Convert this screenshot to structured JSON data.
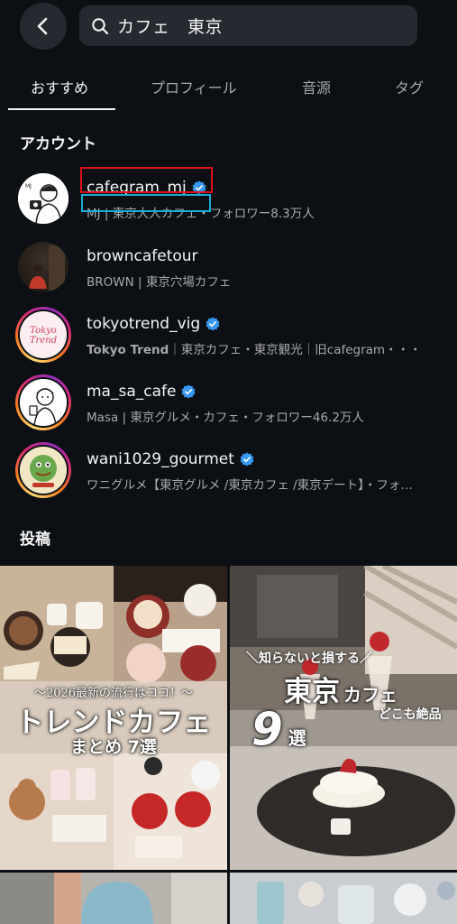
{
  "search": {
    "query": "カフェ　東京"
  },
  "tabs": [
    {
      "label": "おすすめ"
    },
    {
      "label": "プロフィール"
    },
    {
      "label": "音源"
    },
    {
      "label": "タグ"
    }
  ],
  "sections": {
    "accounts": "アカウント",
    "posts": "投稿"
  },
  "accounts": [
    {
      "username": "cafegram_mj",
      "verified": true,
      "sub_highlight": "MJ | 東京大人カフェ",
      "sub_rest": "・フォロワー8.3万人"
    },
    {
      "username": "browncafetour",
      "verified": false,
      "subtitle": "BROWN | 東京穴場カフェ"
    },
    {
      "username": "tokyotrend_vig",
      "verified": true,
      "sub_bold": "Tokyo Trend",
      "sub_rest": "｜東京カフェ・東京観光｜旧cafegram・・・",
      "avatar_text": "Tokyo Trend"
    },
    {
      "username": "ma_sa_cafe",
      "verified": true,
      "subtitle": "Masa | 東京グルメ・カフェ・フォロワー46.2万人"
    },
    {
      "username": "wani1029_gourmet",
      "verified": true,
      "subtitle": "ワニグルメ【東京グルメ /東京カフェ /東京デート】・フォ…"
    }
  ],
  "posts": [
    {
      "line1": "～2026最新の流行はココ！～",
      "line2": "トレンドカフェ",
      "line3": "まとめ 7選"
    },
    {
      "banner": "＼知らないと損する／",
      "big": "東京",
      "small": "カフェ",
      "tag": "どこも絶品",
      "number": "9",
      "unit": "選"
    }
  ],
  "colors": {
    "background": "#0c1014",
    "verified": "#3897f0",
    "highlight_red": "#e0131c",
    "highlight_cyan": "#1aaed6"
  }
}
